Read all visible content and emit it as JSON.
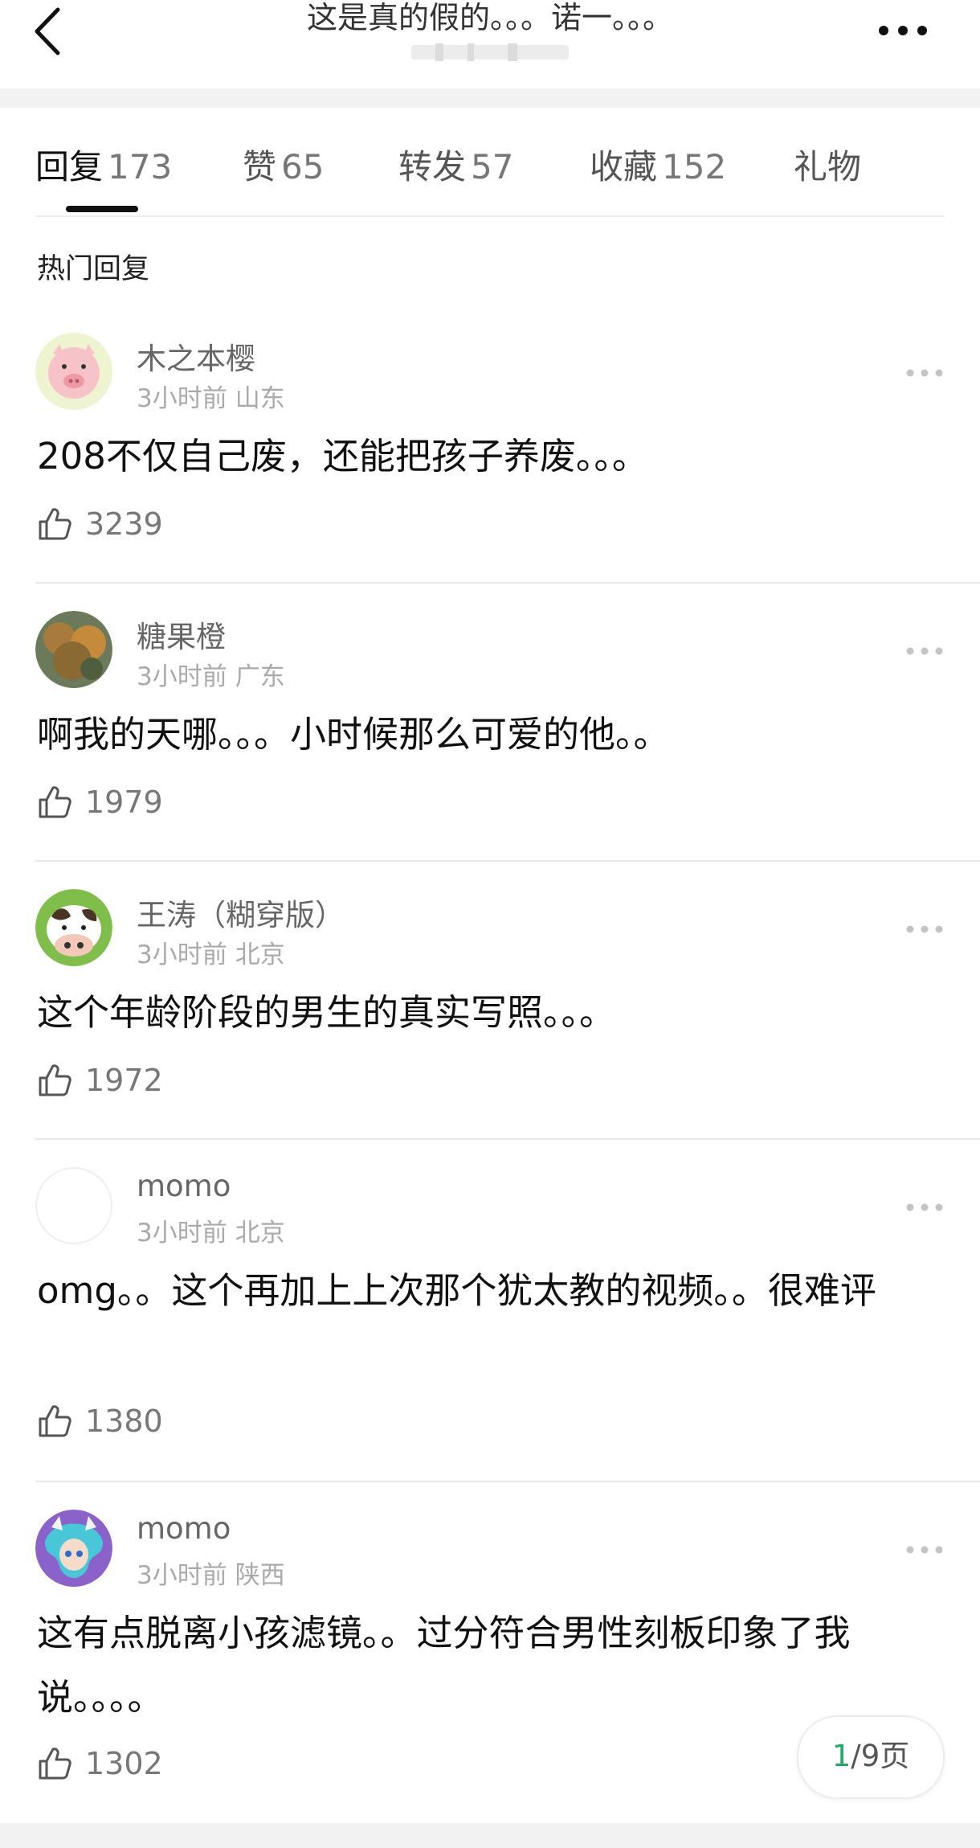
{
  "header": {
    "title": "这是真的假的。。。诺一。。。"
  },
  "tabs": [
    {
      "label": "回复",
      "count": "173"
    },
    {
      "label": "赞",
      "count": "65"
    },
    {
      "label": "转发",
      "count": "57"
    },
    {
      "label": "收藏",
      "count": "152"
    },
    {
      "label": "礼物",
      "count": ""
    }
  ],
  "section_title": "热门回复",
  "comments": [
    {
      "name": "木之本樱",
      "time": "3小时前",
      "location": "山东",
      "text": "208不仅自己废，还能把孩子养废。。。",
      "likes": "3239",
      "avatar": "pig-avatar"
    },
    {
      "name": "糖果橙",
      "time": "3小时前",
      "location": "广东",
      "text": "啊我的天哪。。。小时候那么可爱的他。。",
      "likes": "1979",
      "avatar": "tree-avatar"
    },
    {
      "name": "王涛（糊穿版）",
      "time": "3小时前",
      "location": "北京",
      "text": "这个年龄阶段的男生的真实写照。。。",
      "likes": "1972",
      "avatar": "cow-avatar"
    },
    {
      "name": "momo",
      "time": "3小时前",
      "location": "北京",
      "text": "omg。。这个再加上上次那个犹太教的视频。。很难评",
      "likes": "1380",
      "avatar": "blank-avatar"
    },
    {
      "name": "momo",
      "time": "3小时前",
      "location": "陕西",
      "text": "这有点脱离小孩滤镜。。过分符合男性刻板印象了我说。。。。",
      "likes": "1302",
      "avatar": "anime-avatar"
    }
  ],
  "pager": {
    "current": "1",
    "total_label": "/9页"
  }
}
